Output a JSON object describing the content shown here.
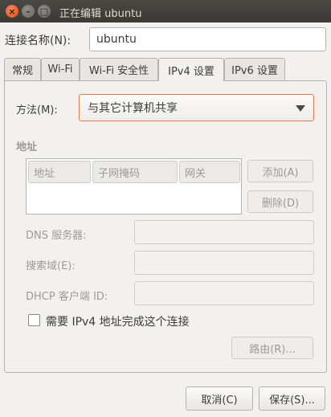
{
  "window": {
    "title": "正在编辑 ubuntu",
    "close_glyph": "×",
    "min_glyph": "–",
    "max_glyph": "□"
  },
  "connection": {
    "name_label": "连接名称(N):",
    "name_value": "ubuntu"
  },
  "tabs": [
    {
      "label": "常规",
      "active": false
    },
    {
      "label": "Wi-Fi",
      "active": false
    },
    {
      "label": "Wi-Fi 安全性",
      "active": false
    },
    {
      "label": "IPv4 设置",
      "active": true
    },
    {
      "label": "IPv6 设置",
      "active": false
    }
  ],
  "ipv4": {
    "method_label": "方法(M):",
    "method_value": "与其它计算机共享",
    "addresses_title": "地址",
    "columns": [
      "地址",
      "子网掩码",
      "网关"
    ],
    "add_button": "添加(A)",
    "delete_button": "删除(D)",
    "dns_label": "DNS 服务器:",
    "dns_value": "",
    "search_domain_label": "搜索域(E):",
    "search_domain_value": "",
    "dhcp_client_id_label": "DHCP 客户端 ID:",
    "dhcp_client_id_value": "",
    "require_ipv4_label": "需要 IPv4 地址完成这个连接",
    "require_ipv4_checked": false,
    "routes_button": "路由(R)..."
  },
  "footer": {
    "cancel_button": "取消(C)",
    "save_button": "保存(S)..."
  },
  "colors": {
    "accent": "#e07a4a",
    "close_button": "#df4a16",
    "titlebar": "#3c3b37"
  }
}
